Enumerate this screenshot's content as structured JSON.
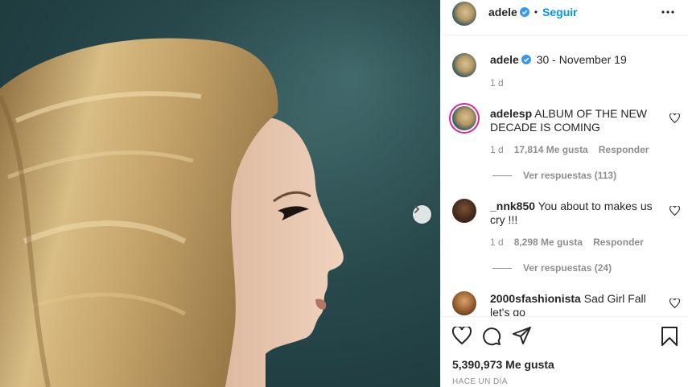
{
  "post": {
    "author": "adele",
    "follow_label": "Seguir",
    "separator": "•",
    "caption": "30 - November 19",
    "caption_time": "1 d"
  },
  "comments": [
    {
      "user": "adelesp",
      "text": "ALBUM OF THE NEW DECADE IS COMING",
      "time": "1 d",
      "likes": "17,814 Me gusta",
      "reply_label": "Responder",
      "view_replies": "Ver respuestas (113)"
    },
    {
      "user": "_nnk850",
      "text": "You about to makes us cry !!!",
      "time": "1 d",
      "likes": "8,298 Me gusta",
      "reply_label": "Responder",
      "view_replies": "Ver respuestas (24)"
    },
    {
      "user": "2000sfashionista",
      "text": "Sad Girl Fall let's go"
    }
  ],
  "footer": {
    "likes": "5,390,973 Me gusta",
    "timestamp": "HACE UN DÍA"
  },
  "icons": {
    "verified": "verified-badge-icon",
    "more": "more-options-icon",
    "like": "heart-icon",
    "comment": "comment-bubble-icon",
    "share": "paper-plane-icon",
    "save": "bookmark-icon",
    "next": "chevron-right-icon"
  },
  "colors": {
    "link": "#0095f6",
    "verified": "#3897f0",
    "muted": "#8e8e8e",
    "text": "#262626"
  }
}
